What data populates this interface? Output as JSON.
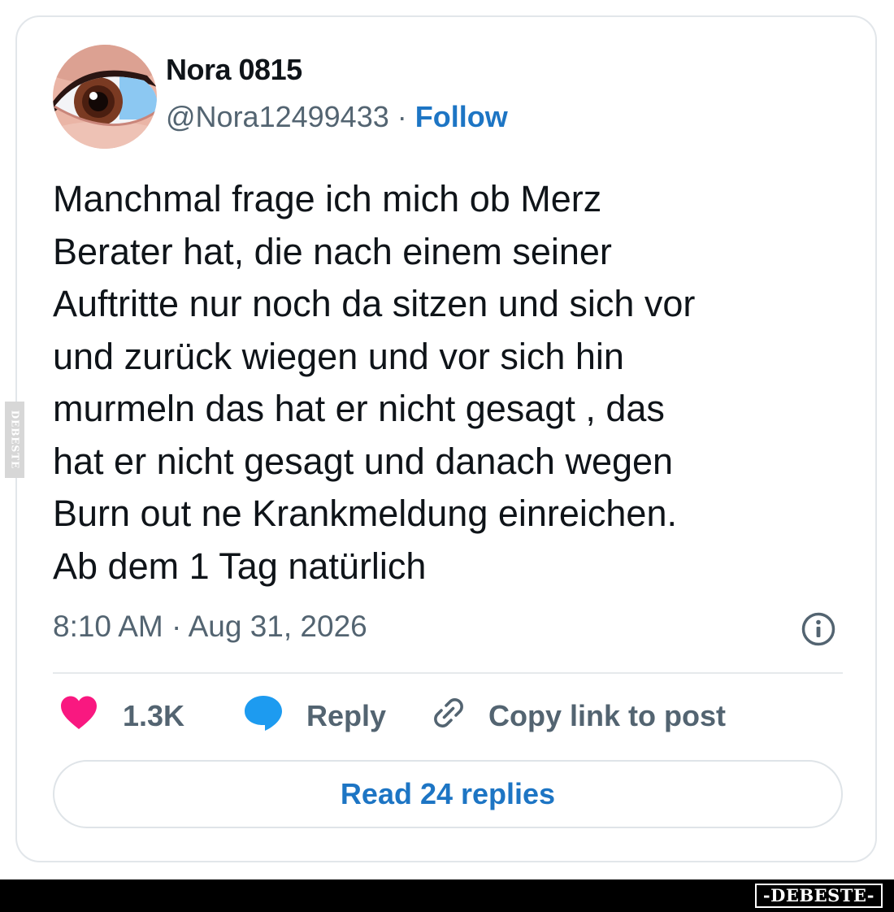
{
  "author": {
    "display_name": "Nora 0815",
    "handle": "@Nora12499433",
    "separator": "·",
    "follow_label": "Follow",
    "avatar_icon": "eye-avatar"
  },
  "tweet": {
    "text": "Manchmal frage ich mich ob Merz\nBerater hat, die nach einem seiner\nAuftritte nur noch da sitzen und sich vor\nund zurück wiegen und vor sich hin\nmurmeln das hat er nicht gesagt , das\nhat er nicht gesagt und danach wegen\nBurn out ne Krankmeldung einreichen.\nAb dem 1 Tag natürlich",
    "timestamp": "8:10 AM · Aug 31, 2026"
  },
  "actions": {
    "like_count": "1.3K",
    "reply_label": "Reply",
    "copy_link_label": "Copy link to post"
  },
  "read_replies_label": "Read 24 replies",
  "watermark": {
    "footer": "-DEBESTE-",
    "side": "DEBESTE"
  },
  "colors": {
    "like": "#f91880",
    "reply": "#1d9bf0",
    "link": "#1d75c4",
    "muted": "#536471",
    "text": "#0f1419"
  }
}
